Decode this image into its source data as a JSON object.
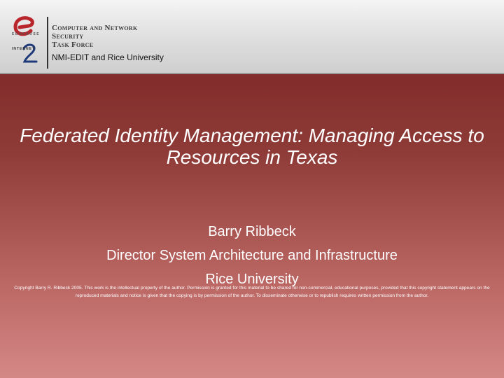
{
  "header": {
    "org_line1": "Computer and Network",
    "org_line2": "Security",
    "org_line3": "Task Force",
    "subtitle": "NMI-EDIT and Rice University",
    "logo_educause": "EDUCAUSE",
    "logo_internet2": "INTERNET"
  },
  "slide": {
    "title": "Federated Identity Management: Managing Access to Resources in Texas",
    "author_name": "Barry Ribbeck",
    "author_role": "Director System Architecture and Infrastructure",
    "author_org": "Rice University",
    "copyright": "Copyright Barry R. Ribbeck 2005. This work is the intellectual property of the author. Permission is granted for this material to be shared for non-commercial, educational purposes, provided that this copyright statement appears on the reproduced materials and notice is given that the copying is by permission of the author. To disseminate otherwise or to republish requires written permission from the author."
  },
  "colors": {
    "background_top": "#761f1e",
    "background_bottom": "#d48886",
    "header_bg": "#e2e2e2",
    "text": "#ffffff",
    "logo_red": "#b8262b"
  }
}
